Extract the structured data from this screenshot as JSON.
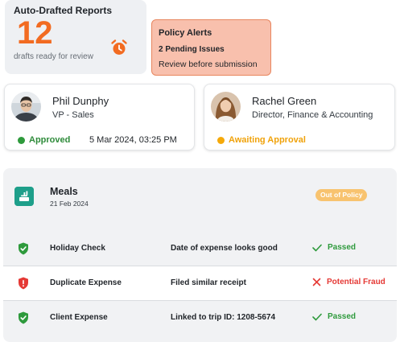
{
  "reports": {
    "title": "Auto-Drafted Reports",
    "count": "12",
    "subtitle": "drafts ready for review",
    "icon": "alarm-clock-icon",
    "accent": "#f26b21"
  },
  "alerts": {
    "title": "Policy Alerts",
    "issues": "2 Pending Issues",
    "review": "Review before submission",
    "bg": "#f8c0ad"
  },
  "approvers": [
    {
      "name": "Phil Dunphy",
      "role": "VP - Sales",
      "status": "Approved",
      "status_color": "#2e9a3c",
      "date": "5 Mar 2024, 03:25 PM"
    },
    {
      "name": "Rachel Green",
      "role": "Director, Finance & Accounting",
      "status": "Awaiting Approval",
      "status_color": "#f5a90a"
    }
  ],
  "expense": {
    "category": "Meals",
    "date": "21 Feb 2024",
    "badge": "Out of Policy",
    "icon": "food-tray-icon",
    "checks": [
      {
        "name": "Holiday Check",
        "detail": "Date of expense looks good",
        "result": "Passed",
        "icon": "shield-check-icon",
        "result_icon": "checkmark-icon"
      },
      {
        "name": "Duplicate Expense",
        "detail": "Filed similar receipt",
        "result": "Potential Fraud",
        "icon": "shield-alert-icon",
        "result_icon": "x-mark-icon"
      },
      {
        "name": "Client Expense",
        "detail": "Linked to trip ID: 1208-5674",
        "result": "Passed",
        "icon": "shield-check-icon",
        "result_icon": "checkmark-icon"
      }
    ]
  }
}
